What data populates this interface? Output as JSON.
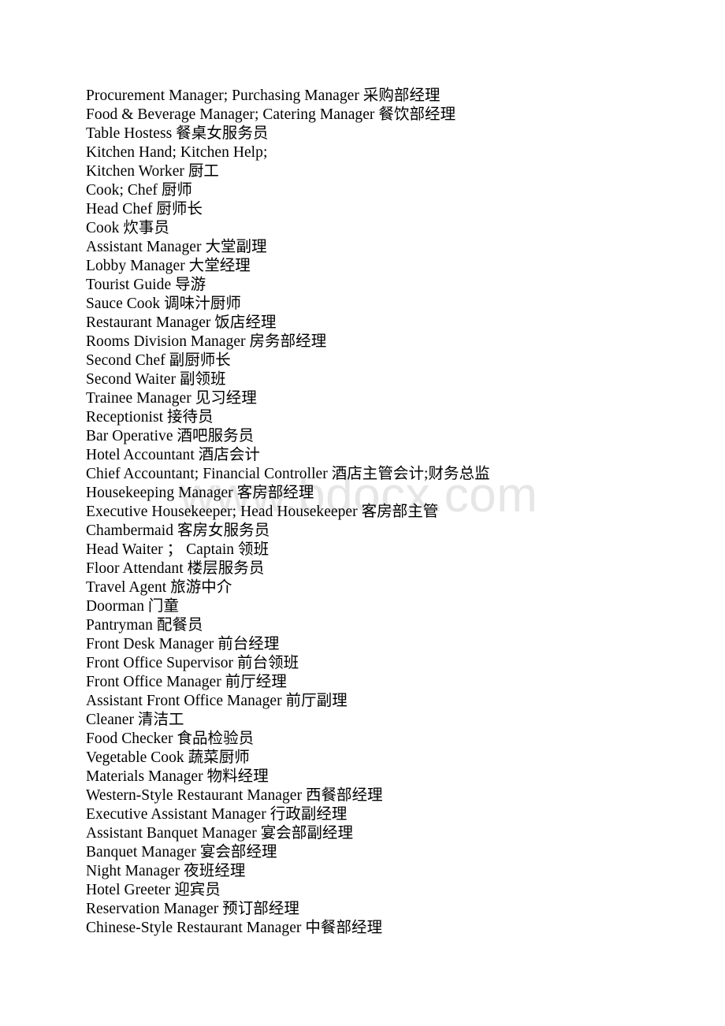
{
  "document": {
    "watermark": "www.bdocx.com",
    "watermark_color": "#e6e6e6",
    "text_color": "#000000",
    "background_color": "#ffffff",
    "lines": [
      "Procurement Manager; Purchasing Manager 采购部经理",
      "Food & Beverage Manager; Catering Manager 餐饮部经理",
      "Table Hostess 餐桌女服务员",
      "Kitchen Hand; Kitchen Help;",
      "Kitchen Worker 厨工",
      "Cook; Chef 厨师",
      "Head Chef 厨师长",
      "Cook 炊事员",
      "Assistant Manager 大堂副理",
      "Lobby Manager 大堂经理",
      "Tourist Guide 导游",
      "Sauce Cook 调味汁厨师",
      "Restaurant Manager 饭店经理",
      "Rooms Division Manager 房务部经理",
      "Second Chef 副厨师长",
      "Second Waiter 副领班",
      "Trainee Manager 见习经理",
      "Receptionist 接待员",
      "Bar Operative 酒吧服务员",
      "Hotel Accountant 酒店会计",
      "Chief Accountant; Financial Controller 酒店主管会计;财务总监",
      "Housekeeping Manager 客房部经理",
      "Executive Housekeeper; Head Housekeeper 客房部主管",
      "Chambermaid 客房女服务员",
      "Head Waiter ； Captain 领班",
      "Floor Attendant 楼层服务员",
      "Travel Agent 旅游中介",
      "Doorman 门童",
      "Pantryman 配餐员",
      "Front Desk Manager 前台经理",
      "Front Office Supervisor 前台领班",
      "Front Office Manager 前厅经理",
      "Assistant Front Office Manager 前厅副理",
      "Cleaner 清洁工",
      "Food Checker 食品检验员",
      "Vegetable Cook 蔬菜厨师",
      "Materials Manager 物料经理",
      "Western-Style Restaurant Manager 西餐部经理",
      "Executive Assistant Manager 行政副经理",
      "Assistant Banquet Manager 宴会部副经理",
      "Banquet Manager 宴会部经理",
      "Night Manager 夜班经理",
      "Hotel Greeter 迎宾员",
      "Reservation Manager 预订部经理",
      "Chinese-Style Restaurant Manager 中餐部经理"
    ]
  }
}
